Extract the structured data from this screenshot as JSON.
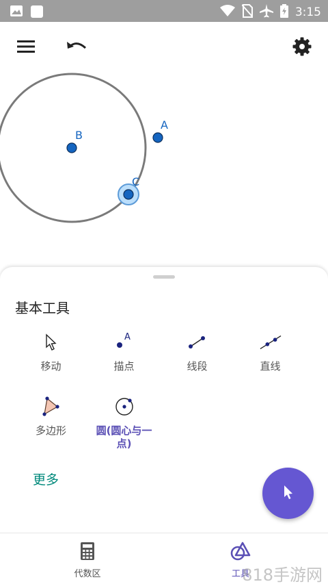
{
  "status_bar": {
    "time": "3:15",
    "icons": [
      "image-icon",
      "square-icon",
      "wifi-icon",
      "no-sim-icon",
      "airplane-icon",
      "battery-icon"
    ]
  },
  "toolbar": {
    "menu_icon": "menu-icon",
    "undo_icon": "undo-icon",
    "settings_icon": "gear-icon"
  },
  "canvas": {
    "points": [
      {
        "label": "A"
      },
      {
        "label": "B"
      },
      {
        "label": "C"
      }
    ],
    "colors": {
      "point_fill": "#1565c0",
      "circle_stroke": "#7a7a7a",
      "selected_halo": "#90caf9"
    }
  },
  "sheet": {
    "title": "基本工具",
    "tools": [
      {
        "label": "移动",
        "icon": "move-arrow-icon"
      },
      {
        "label": "描点",
        "icon": "point-icon"
      },
      {
        "label": "线段",
        "icon": "segment-icon"
      },
      {
        "label": "直线",
        "icon": "line-icon"
      },
      {
        "label": "多边形",
        "icon": "polygon-icon"
      },
      {
        "label": "圆(圆心与一点)",
        "icon": "circle-center-point-icon"
      }
    ],
    "more": "更多"
  },
  "fab": {
    "icon": "cursor-icon",
    "color": "#6557d2"
  },
  "bottom_nav": {
    "items": [
      {
        "label": "代数区",
        "icon": "calculator-icon"
      },
      {
        "label": "工具",
        "icon": "shapes-icon"
      }
    ]
  },
  "watermark": "818手游网"
}
